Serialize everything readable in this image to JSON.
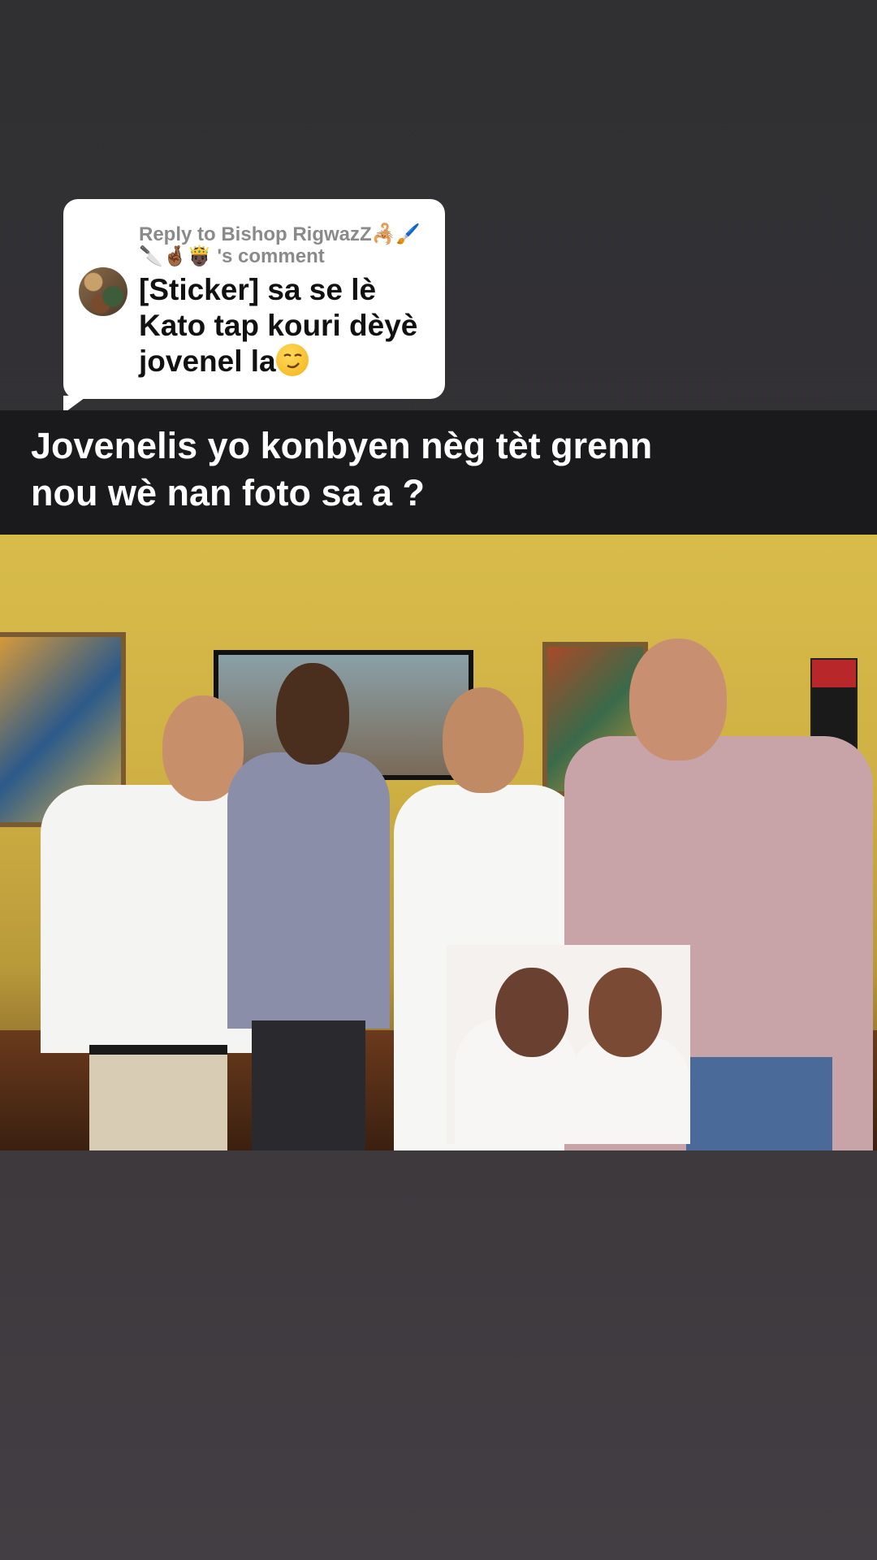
{
  "reply": {
    "meta_prefix": "Reply to Bishop RigwazZ",
    "meta_emojis_1": "🦂🖌️",
    "meta_emojis_2": "🔪🤞🏾🤴🏿",
    "meta_suffix": "'s comment",
    "text": "[Sticker] sa se lè Kato tap kouri dèyè jovenel la",
    "emoji": "😏"
  },
  "caption": {
    "line1": "Jovenelis yo konbyen nèg tèt grenn",
    "line2": "nou wè nan foto sa a ?"
  }
}
